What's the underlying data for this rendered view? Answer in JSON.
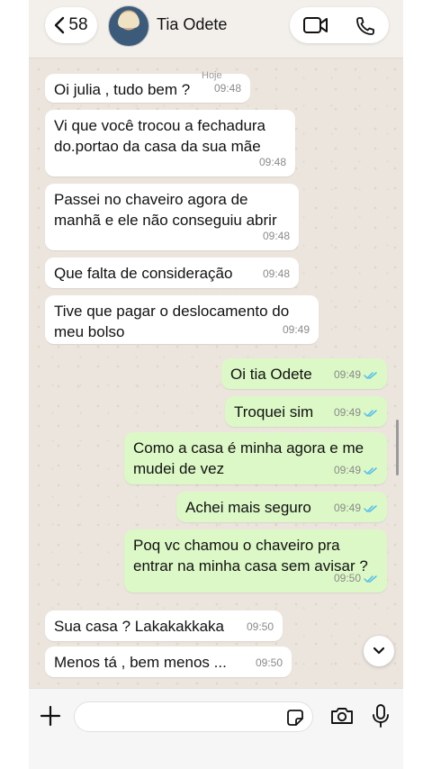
{
  "header": {
    "unread_count": "58",
    "contact_name": "Tia Odete",
    "day_label": "Hoje"
  },
  "messages": [
    {
      "dir": "in",
      "text": "Oi julia , tudo bem ?",
      "time": "09:48"
    },
    {
      "dir": "in",
      "text": "Vi que você trocou a fechadura\ndo.portao da casa da sua mãe",
      "time": "09:48"
    },
    {
      "dir": "in",
      "text": "Passei no chaveiro agora de\nmanhã e ele não conseguiu abrir",
      "time": "09:48"
    },
    {
      "dir": "in",
      "text": "Que falta de consideração",
      "time": "09:48"
    },
    {
      "dir": "in",
      "text": "Tive que pagar o deslocamento do\nmeu bolso",
      "time": "09:49"
    },
    {
      "dir": "out",
      "text": "Oi tia Odete",
      "time": "09:49"
    },
    {
      "dir": "out",
      "text": "Troquei sim",
      "time": "09:49"
    },
    {
      "dir": "out",
      "text": "Como a casa é minha agora e me\nmudei de vez",
      "time": "09:49"
    },
    {
      "dir": "out",
      "text": "Achei mais seguro",
      "time": "09:49"
    },
    {
      "dir": "out",
      "text": "Poq vc chamou o chaveiro pra\nentrar na minha casa sem avisar ?",
      "time": "09:50"
    },
    {
      "dir": "in",
      "text": "Sua casa ? Lakakakkaka",
      "time": "09:50"
    },
    {
      "dir": "in",
      "text": "Menos tá , bem menos ...",
      "time": "09:50"
    }
  ],
  "colors": {
    "incoming_bubble": "#ffffff",
    "outgoing_bubble": "#dcf8c6",
    "read_ticks": "#53bdeb",
    "wallpaper": "#ece5dd"
  },
  "icons": {
    "back": "chevron-left-icon",
    "video": "video-camera-icon",
    "call": "phone-icon",
    "scroll_down": "chevron-down-icon",
    "attach": "plus-icon",
    "sticker": "sticker-icon",
    "camera": "camera-icon",
    "mic": "microphone-icon"
  }
}
